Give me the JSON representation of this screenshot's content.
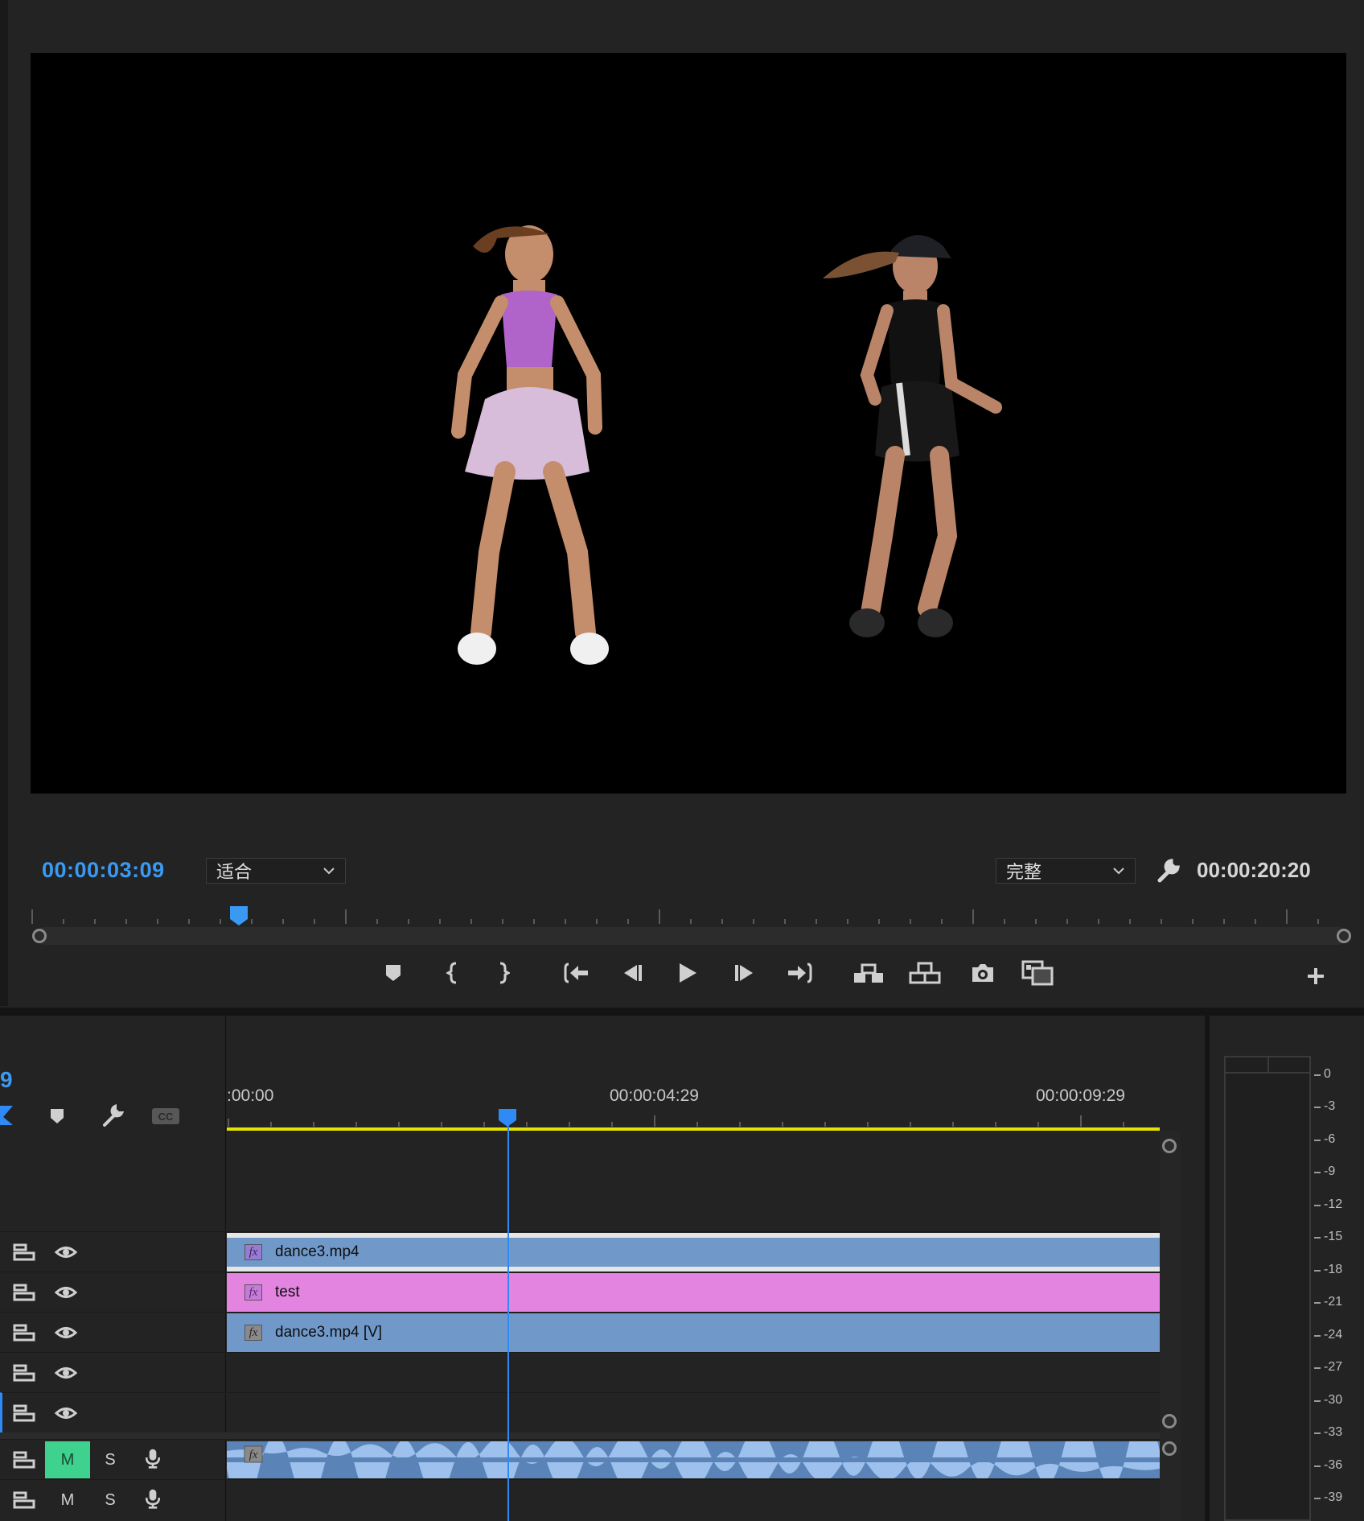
{
  "monitor": {
    "current_timecode": "00:00:03:09",
    "zoom_dropdown": "适合",
    "quality_dropdown": "完整",
    "duration_timecode": "00:00:20:20"
  },
  "transport": {
    "buttons": [
      "marker-icon",
      "mark-in-icon",
      "mark-out-icon",
      "go-to-in-icon",
      "step-back-icon",
      "play-icon",
      "step-forward-icon",
      "go-to-out-icon",
      "insert-icon",
      "overwrite-icon",
      "export-frame-icon",
      "comparison-view-icon",
      "add-button-icon"
    ]
  },
  "timeline": {
    "sequence_timecode": "9",
    "ruler_labels": [
      ":00:00",
      "00:00:04:29",
      "00:00:09:29"
    ],
    "clips": [
      {
        "name": "dance3.mp4",
        "color": "#7099c9"
      },
      {
        "name": "test",
        "color": "#e384e0"
      },
      {
        "name": "dance3.mp4 [V]",
        "color": "#7099c9"
      }
    ],
    "audio_m_label": "M",
    "audio_s_label": "S"
  },
  "meter": {
    "db_labels": [
      "0",
      "-3",
      "-6",
      "-9",
      "-12",
      "-15",
      "-18",
      "-21",
      "-24",
      "-27",
      "-30",
      "-33",
      "-36",
      "-39"
    ]
  }
}
